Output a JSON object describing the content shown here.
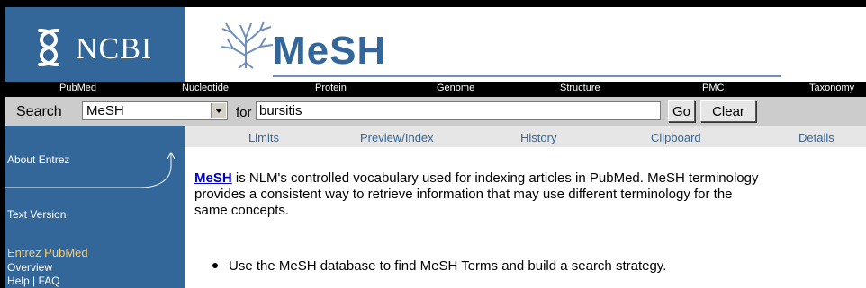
{
  "logo": {
    "ncbi_text": "NCBI",
    "mesh_title": "MeSH"
  },
  "db_nav": [
    {
      "label": "PubMed"
    },
    {
      "label": "Nucleotide"
    },
    {
      "label": "Protein"
    },
    {
      "label": "Genome"
    },
    {
      "label": "Structure"
    },
    {
      "label": "PMC"
    },
    {
      "label": "Taxonomy"
    }
  ],
  "search": {
    "label": "Search",
    "database": "MeSH",
    "for_label": "for",
    "term": "bursitis",
    "go_label": "Go",
    "clear_label": "Clear"
  },
  "tabs": [
    {
      "label": "Limits"
    },
    {
      "label": "Preview/Index"
    },
    {
      "label": "History"
    },
    {
      "label": "Clipboard"
    },
    {
      "label": "Details"
    }
  ],
  "sidebar": {
    "about": "About Entrez",
    "text_version": "Text Version",
    "section_title": "Entrez PubMed",
    "overview": "Overview",
    "help_faq": "Help | FAQ"
  },
  "main": {
    "mesh_link": "MeSH",
    "intro_line1": " is NLM's controlled vocabulary used for indexing articles in PubMed. MeSH terminology",
    "intro_line2": "provides a consistent way to retrieve information that may use different terminology for the",
    "intro_line3": "same concepts.",
    "bullet1": "Use the MeSH database to find MeSH Terms and build a search strategy."
  },
  "colors": {
    "brand_blue": "#336699",
    "nav_black": "#000000",
    "search_gray": "#cccccc",
    "sidebar_highlight": "#ffcc66"
  }
}
